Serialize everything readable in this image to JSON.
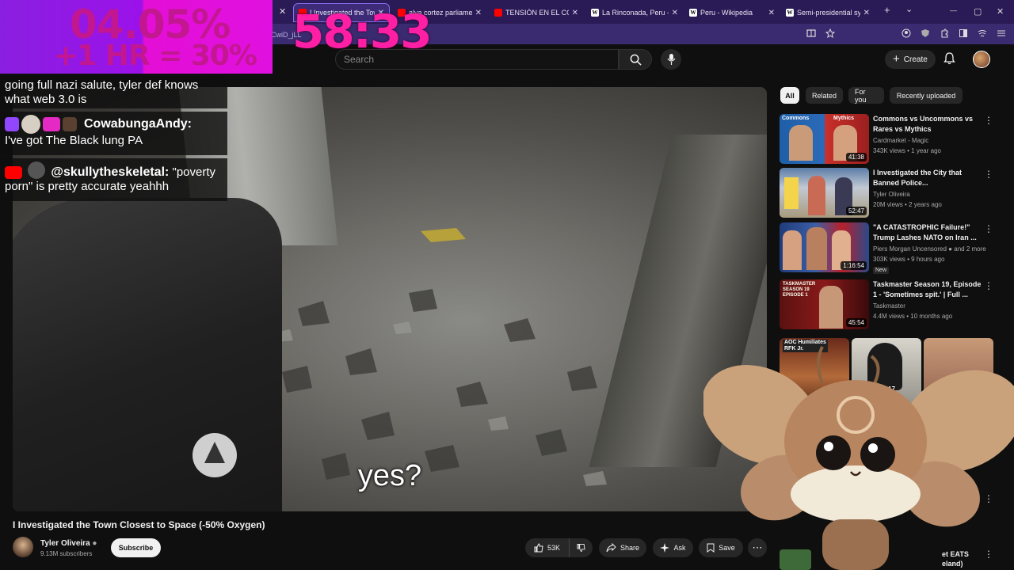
{
  "browser": {
    "address_partial": "CwiD_jLL",
    "tabs": [
      {
        "label": "I Investigated the Town",
        "type": "yt",
        "active": true
      },
      {
        "label": "alva cortez parliament -",
        "type": "yt",
        "active": false
      },
      {
        "label": "TENSIÓN EN EL CON",
        "type": "yt",
        "active": false
      },
      {
        "label": "La Rinconada, Peru - Wik",
        "type": "wiki",
        "active": false
      },
      {
        "label": "Peru - Wikipedia",
        "type": "wiki",
        "active": false
      },
      {
        "label": "Semi-presidential syster",
        "type": "wiki",
        "active": false
      }
    ],
    "wiki_icon_letter": "W",
    "new_tab": "+",
    "tab_dropdown": "⌄",
    "minimize": "—",
    "maximize": "▢",
    "close": "✕",
    "tab_close": "✕"
  },
  "header": {
    "search_placeholder": "Search",
    "create_label": "Create",
    "create_icon": "+"
  },
  "overlay": {
    "percent_main": "04.05%",
    "percent_sub": "+1 HR = 30%",
    "timer": "58:33",
    "colors": {
      "panel": "#9b12e9",
      "panel_right": "#e010e0",
      "digits": "#c21790",
      "timer": "#ff1fa5"
    }
  },
  "chat": [
    {
      "username": "",
      "message": "going full nazi salute, tyler def knows what web 3.0 is"
    },
    {
      "username": "CowabungaAndy:",
      "message": "I've got The Black lung PA"
    },
    {
      "username": "@skullytheskeletal:",
      "message": "\"poverty porn\" is pretty accurate yeahhh"
    }
  ],
  "video": {
    "subtitle": "yes?",
    "title": "I Investigated the Town Closest to Space (-50% Oxygen)",
    "channel": "Tyler Oliveira",
    "subscribers": "9.13M subscribers",
    "subscribe_label": "Subscribe",
    "likes": "53K",
    "share_label": "Share",
    "ask_label": "Ask",
    "save_label": "Save",
    "more_label": "⋯"
  },
  "chips": [
    {
      "label": "All",
      "active": true
    },
    {
      "label": "Related",
      "active": false
    },
    {
      "label": "For you",
      "active": false
    },
    {
      "label": "Recently uploaded",
      "active": false
    }
  ],
  "recommended": [
    {
      "title": "Commons vs Uncommons vs Rares vs Mythics",
      "channel": "Cardmarket - Magic",
      "meta": "343K views • 1 year ago",
      "duration": "41:38",
      "thumb_text": [
        "Commons",
        "Mythics"
      ]
    },
    {
      "title": "I Investigated the City that Banned Police...",
      "channel": "Tyler Oliveira",
      "meta": "20M views • 2 years ago",
      "duration": "52:47"
    },
    {
      "title": "\"A CATASTROPHIC Failure!\" Trump Lashes NATO on Iran ...",
      "channel": "Piers Morgan Uncensored",
      "extra": "and 2 more",
      "meta": "303K views • 9 hours ago",
      "duration": "1:16:54",
      "badge": "New"
    },
    {
      "title": "Taskmaster Season 19, Episode 1 - 'Sometimes spit.' | Full ...",
      "channel": "Taskmaster",
      "meta": "4.4M views • 10 months ago",
      "duration": "45:54",
      "thumb_text": [
        "TASKMASTER",
        "SEASON 19",
        "EPISODE 1"
      ]
    }
  ],
  "shorts": [
    {
      "thumb_text": [
        "AOC Humiliates",
        "RFK Jr."
      ]
    },
    {
      "thumb_text": [
        "I'm only 17"
      ]
    }
  ],
  "partial_rec": {
    "title_fragment": "et EATS",
    "title_fragment2": "eland)"
  },
  "more_icon": "⋮"
}
